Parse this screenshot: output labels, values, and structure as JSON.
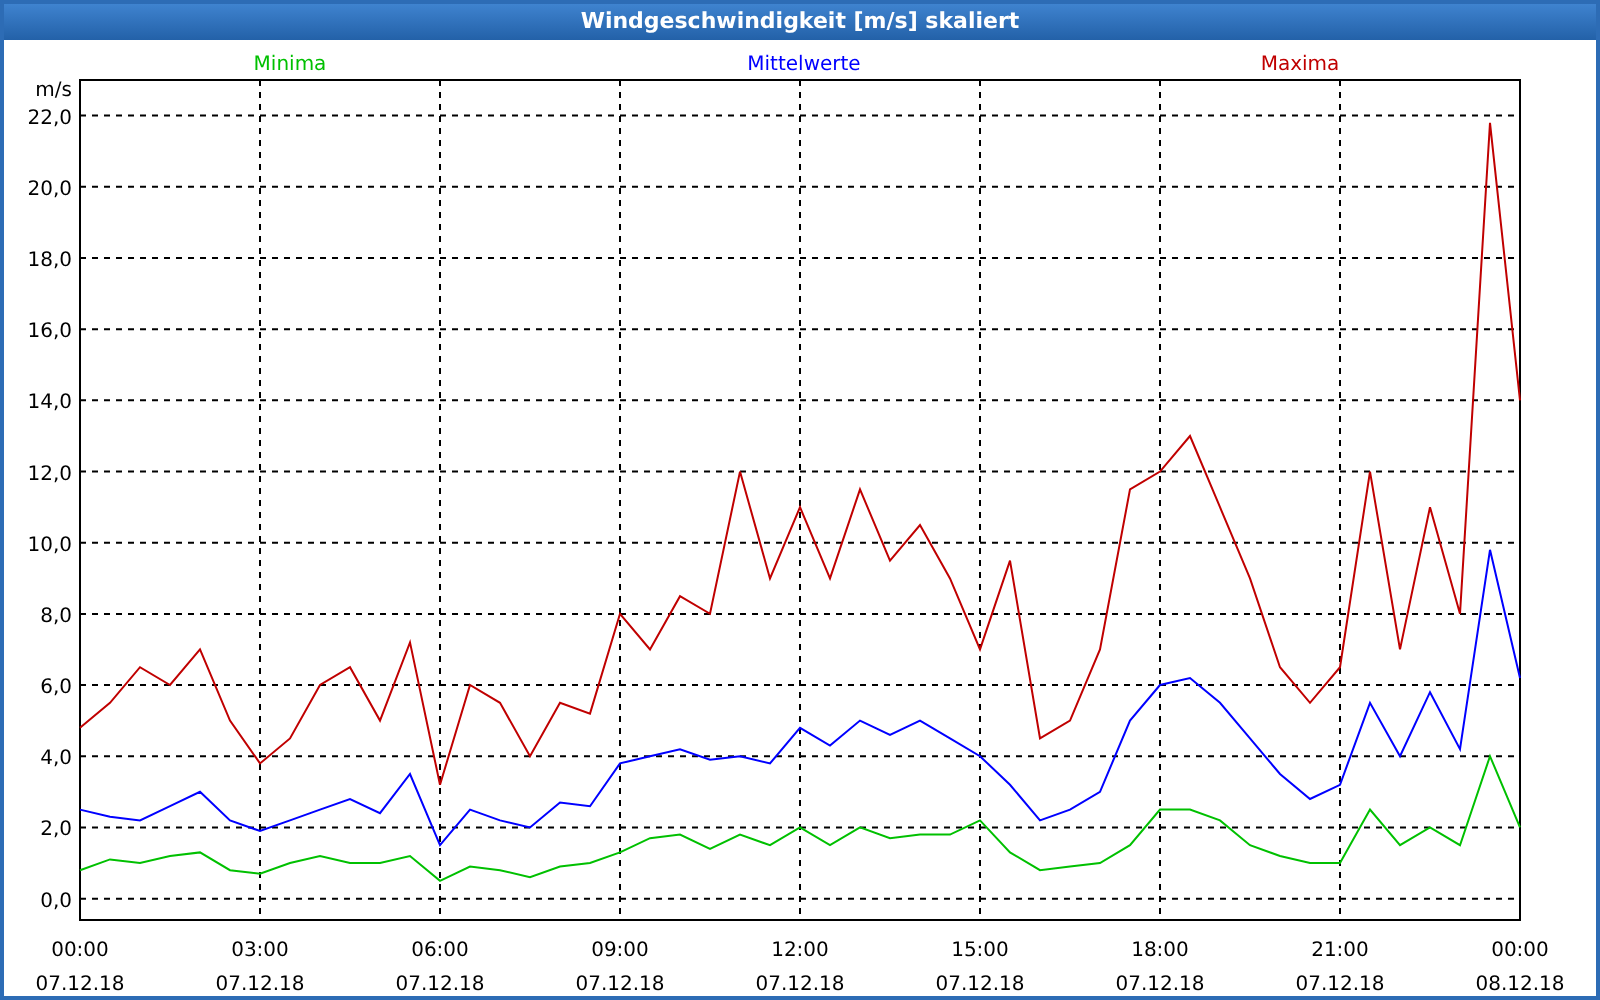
{
  "window": {
    "title": "Windgeschwindigkeit [m/s] skaliert"
  },
  "chart": {
    "chart_data": {
      "type": "line",
      "grid": true,
      "ylabel": "m/s",
      "ylim": [
        -0.6,
        23
      ],
      "categories": [
        "00:00 07.12.18",
        null,
        null,
        null,
        null,
        null,
        "03:00 07.12.18",
        null,
        null,
        null,
        null,
        null,
        "06:00 07.12.18",
        null,
        null,
        null,
        null,
        null,
        "09:00 07.12.18",
        null,
        null,
        null,
        null,
        null,
        "12:00 07.12.18",
        null,
        null,
        null,
        null,
        null,
        "15:00 07.12.18",
        null,
        null,
        null,
        null,
        null,
        "18:00 07.12.18",
        null,
        null,
        null,
        null,
        null,
        "21:00 07.12.18",
        null,
        null,
        null,
        null,
        null,
        "00:00 08.12.18"
      ],
      "series": [
        {
          "name": "Minima",
          "color": "#00c000",
          "values": [
            0.8,
            1.1,
            1.0,
            1.2,
            1.3,
            0.8,
            0.7,
            1.0,
            1.2,
            1.0,
            1.0,
            1.2,
            0.5,
            0.9,
            0.8,
            0.6,
            0.9,
            1.0,
            1.3,
            1.7,
            1.8,
            1.4,
            1.8,
            1.5,
            2.0,
            1.5,
            2.0,
            1.7,
            1.8,
            1.8,
            2.2,
            1.3,
            0.8,
            0.9,
            1.0,
            1.5,
            2.5,
            2.5,
            2.2,
            1.5,
            1.2,
            1.0,
            1.0,
            2.5,
            1.5,
            2.0,
            1.5,
            4.0,
            2.0
          ]
        },
        {
          "name": "Mittelwerte",
          "color": "#0000ff",
          "values": [
            2.5,
            2.3,
            2.2,
            2.6,
            3.0,
            2.2,
            1.9,
            2.2,
            2.5,
            2.8,
            2.4,
            3.5,
            1.5,
            2.5,
            2.2,
            2.0,
            2.7,
            2.6,
            3.8,
            4.0,
            4.2,
            3.9,
            4.0,
            3.8,
            4.8,
            4.3,
            5.0,
            4.6,
            5.0,
            4.5,
            4.0,
            3.2,
            2.2,
            2.5,
            3.0,
            5.0,
            6.0,
            6.2,
            5.5,
            4.5,
            3.5,
            2.8,
            3.2,
            5.5,
            4.0,
            5.8,
            4.2,
            9.8,
            6.2
          ]
        },
        {
          "name": "Maxima",
          "color": "#c00000",
          "values": [
            4.8,
            5.5,
            6.5,
            6.0,
            7.0,
            5.0,
            3.8,
            4.5,
            6.0,
            6.5,
            5.0,
            7.2,
            3.2,
            6.0,
            5.5,
            4.0,
            5.5,
            5.2,
            8.0,
            7.0,
            8.5,
            8.0,
            12.0,
            9.0,
            11.0,
            9.0,
            11.5,
            9.5,
            10.5,
            9.0,
            7.0,
            9.5,
            4.5,
            5.0,
            7.0,
            11.5,
            12.0,
            13.0,
            11.0,
            9.0,
            6.5,
            5.5,
            6.5,
            12.0,
            7.0,
            11.0,
            8.0,
            21.8,
            14.0
          ]
        }
      ],
      "yticks": [
        {
          "value": 0,
          "label": "0,0"
        },
        {
          "value": 2,
          "label": "2,0"
        },
        {
          "value": 4,
          "label": "4,0"
        },
        {
          "value": 6,
          "label": "6,0"
        },
        {
          "value": 8,
          "label": "8,0"
        },
        {
          "value": 10,
          "label": "10,0"
        },
        {
          "value": 12,
          "label": "12,0"
        },
        {
          "value": 14,
          "label": "14,0"
        },
        {
          "value": 16,
          "label": "16,0"
        },
        {
          "value": 18,
          "label": "18,0"
        },
        {
          "value": 20,
          "label": "20,0"
        },
        {
          "value": 22,
          "label": "22,0"
        }
      ]
    }
  }
}
